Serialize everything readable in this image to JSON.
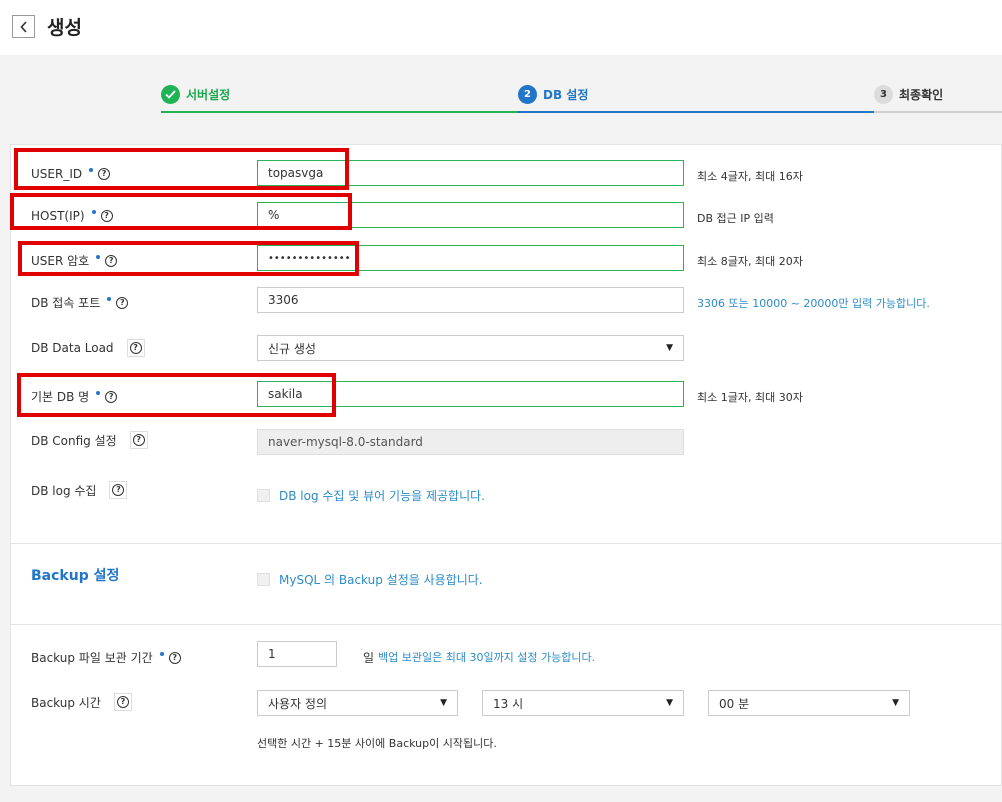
{
  "header": {
    "title": "생성"
  },
  "stepper": {
    "steps": [
      {
        "number": "",
        "label": "서버설정",
        "state": "done"
      },
      {
        "number": "2",
        "label": "DB 설정",
        "state": "active"
      },
      {
        "number": "3",
        "label": "최종확인",
        "state": "pending"
      }
    ]
  },
  "form": {
    "user_id": {
      "label": "USER_ID",
      "value": "topasvga",
      "hint": "최소 4글자, 최대 16자"
    },
    "host_ip": {
      "label": "HOST(IP)",
      "value": "%",
      "hint": "DB 접근 IP 입력"
    },
    "user_password": {
      "label": "USER 암호",
      "value": "••••••••••••••",
      "hint": "최소 8글자, 최대 20자"
    },
    "db_port": {
      "label": "DB 접속 포트",
      "value": "3306",
      "hint": "3306 또는 10000 ~ 20000만 입력 가능합니다."
    },
    "db_data_load": {
      "label": "DB Data Load",
      "value": "신규 생성"
    },
    "default_db_name": {
      "label": "기본 DB 명",
      "value": "sakila",
      "hint": "최소 1글자, 최대 30자"
    },
    "db_config": {
      "label": "DB Config 설정",
      "value": "naver-mysql-8.0-standard"
    },
    "db_log": {
      "label": "DB log 수집",
      "checkbox_label": "DB log 수집 및 뷰어 기능을 제공합니다."
    }
  },
  "backup": {
    "section_title": "Backup 설정",
    "checkbox_label": "MySQL 의 Backup 설정을 사용합니다.",
    "retention": {
      "label": "Backup 파일 보관 기간",
      "value": "1",
      "unit": "일",
      "hint": "백업 보관일은 최대 30일까지 설정 가능합니다."
    },
    "time": {
      "label": "Backup 시간",
      "mode": "사용자 정의",
      "hour": "13 시",
      "minute": "00 분",
      "note": "선택한 시간 + 15분 사이에 Backup이 시작됩니다."
    }
  },
  "icons": {
    "help": "?",
    "check": "✓",
    "caret": "▼",
    "back": "‹"
  },
  "colors": {
    "primary": "#2276c9",
    "success": "#1fb355",
    "highlight": "#e00000"
  }
}
